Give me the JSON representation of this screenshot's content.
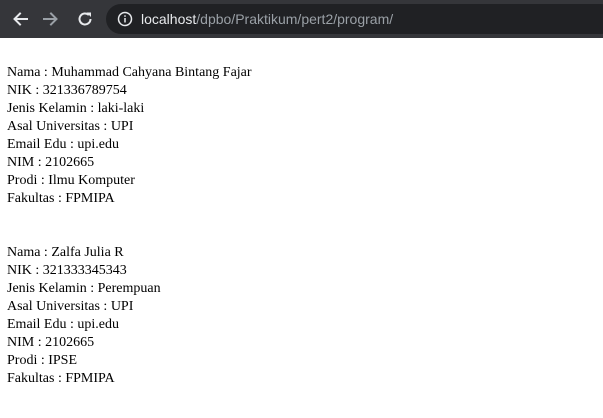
{
  "browser": {
    "url_host": "localhost",
    "url_path": "/dpbo/Praktikum/pert2/program/"
  },
  "records": [
    {
      "nama": "Nama : Muhammad Cahyana Bintang Fajar",
      "nik": "NIK : 321336789754",
      "jenis_kelamin": "Jenis Kelamin : laki-laki",
      "asal_universitas": "Asal Universitas : UPI",
      "email_edu": "Email Edu : upi.edu",
      "nim": "NIM : 2102665",
      "prodi": "Prodi : Ilmu Komputer",
      "fakultas": "Fakultas : FPMIPA"
    },
    {
      "nama": "Nama : Zalfa Julia R",
      "nik": "NIK : 321333345343",
      "jenis_kelamin": "Jenis Kelamin : Perempuan",
      "asal_universitas": "Asal Universitas : UPI",
      "email_edu": "Email Edu : upi.edu",
      "nim": "NIM : 2102665",
      "prodi": "Prodi : IPSE",
      "fakultas": "Fakultas : FPMIPA"
    }
  ]
}
